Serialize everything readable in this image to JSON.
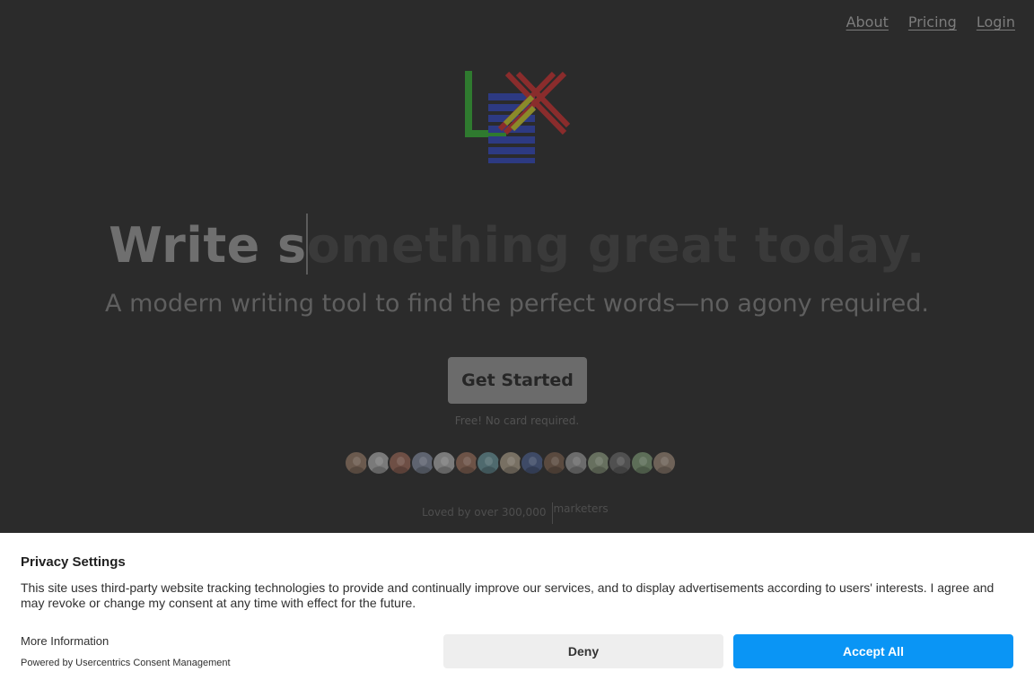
{
  "nav": {
    "links": [
      {
        "label": "About"
      },
      {
        "label": "Pricing"
      },
      {
        "label": "Login"
      }
    ]
  },
  "hero": {
    "headline_typed": "Write s",
    "headline_ghost": "omething great today.",
    "subtitle": "A modern writing tool to find the perfect words—no agony required.",
    "cta_label": "Get Started",
    "free_note": "Free! No card required.",
    "loved_text": "Loved by over 300,000",
    "loved_suffix": "marketers",
    "avatar_count": 15
  },
  "colors": {
    "logo_green": "#2f7a2f",
    "logo_blue": "#2d3a82",
    "logo_red": "#8a2c2c",
    "logo_yellow": "#8a8a2a",
    "accept_button": "#0a95f5",
    "deny_button": "#eeeeee",
    "avatar_tints": [
      "#6b5a4e",
      "#7a7a7a",
      "#6e4f45",
      "#5f6470",
      "#7b7b7b",
      "#6d5347",
      "#4f6a6e",
      "#787063",
      "#3e4a66",
      "#5a4a3f",
      "#6c6c6c",
      "#67705f",
      "#505050",
      "#5d6e58",
      "#6e6258"
    ]
  },
  "consent": {
    "title": "Privacy Settings",
    "text": "This site uses third-party website tracking technologies to provide and continually improve our services, and to display advertisements according to users' interests. I agree and may revoke or change my consent at any time with effect for the future.",
    "more_info": "More Information",
    "powered_by": "Powered by Usercentrics Consent Management",
    "deny_label": "Deny",
    "accept_label": "Accept All"
  }
}
